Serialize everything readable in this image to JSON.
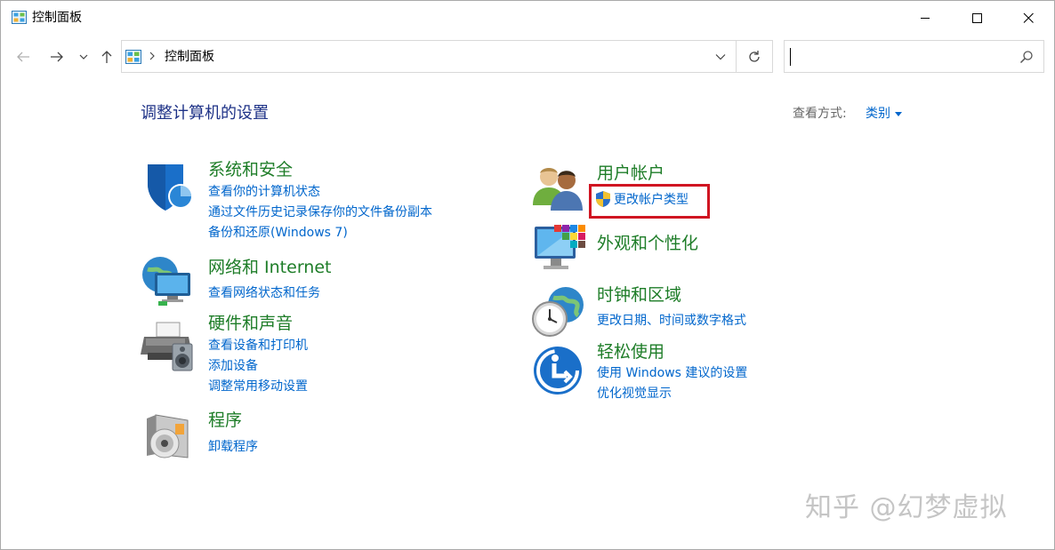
{
  "window": {
    "title": "控制面板"
  },
  "address_bar": {
    "path": "控制面板"
  },
  "search": {
    "value": "",
    "placeholder": ""
  },
  "content": {
    "heading": "调整计算机的设置",
    "view_by_label": "查看方式:",
    "view_by_value": "类别"
  },
  "categories": {
    "system_security": {
      "title": "系统和安全",
      "icon": "shield-icon",
      "links": [
        "查看你的计算机状态",
        "通过文件历史记录保存你的文件备份副本",
        "备份和还原(Windows 7)"
      ]
    },
    "network": {
      "title": "网络和 Internet",
      "icon": "network-globe-icon",
      "links": [
        "查看网络状态和任务"
      ]
    },
    "hardware_sound": {
      "title": "硬件和声音",
      "icon": "printer-speaker-icon",
      "links": [
        "查看设备和打印机",
        "添加设备",
        "调整常用移动设置"
      ]
    },
    "programs": {
      "title": "程序",
      "icon": "programs-disc-icon",
      "links": [
        "卸载程序"
      ]
    },
    "user_accounts": {
      "title": "用户帐户",
      "icon": "users-icon",
      "links": [
        "更改帐户类型"
      ]
    },
    "appearance": {
      "title": "外观和个性化",
      "icon": "monitor-palette-icon",
      "links": []
    },
    "clock_region": {
      "title": "时钟和区域",
      "icon": "clock-globe-icon",
      "links": [
        "更改日期、时间或数字格式"
      ]
    },
    "ease_of_access": {
      "title": "轻松使用",
      "icon": "ease-of-access-icon",
      "links": [
        "使用 Windows 建议的设置",
        "优化视觉显示"
      ]
    }
  },
  "watermark": "知乎 @幻梦虚拟",
  "colors": {
    "category_title": "#1e7d28",
    "link": "#0066cc",
    "heading": "#1e3287",
    "highlight_border": "#d01522"
  }
}
